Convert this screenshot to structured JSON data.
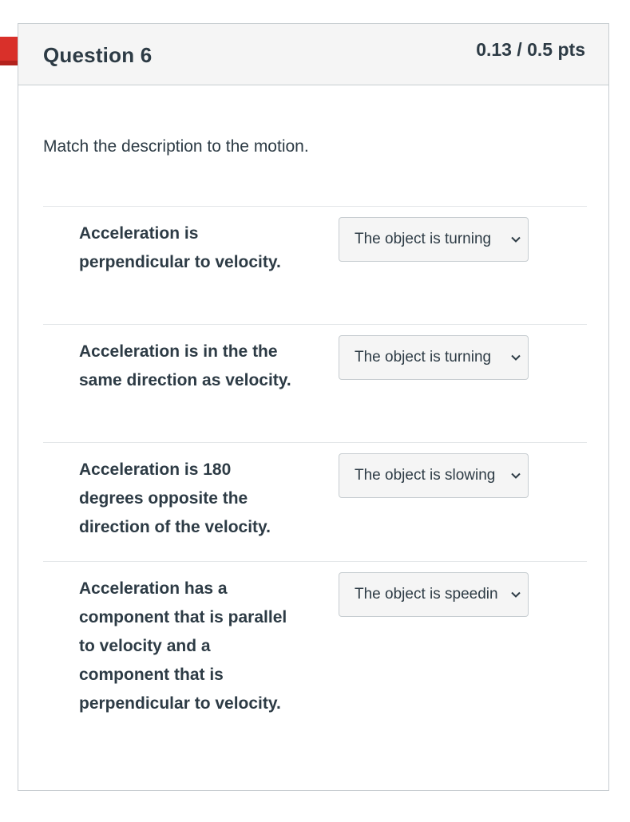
{
  "question": {
    "title": "Question 6",
    "points": "0.13 / 0.5 pts",
    "text": "Match the description to the motion."
  },
  "matches": [
    {
      "label": "Acceleration is perpendicular to velocity.",
      "selected": "The object is turning"
    },
    {
      "label": "Acceleration is in the the same direction as velocity.",
      "selected": "The object is turning"
    },
    {
      "label": "Acceleration is 180 degrees opposite the direction of the velocity.",
      "selected": "The object is slowing"
    },
    {
      "label": "Acceleration has a component that is parallel to velocity and a component that is perpendicular to velocity.",
      "selected": "The object is speeding"
    }
  ],
  "colors": {
    "flag": "#d9302a",
    "text": "#2d3b45",
    "border": "#c7cdd1",
    "header_bg": "#f5f5f5"
  }
}
